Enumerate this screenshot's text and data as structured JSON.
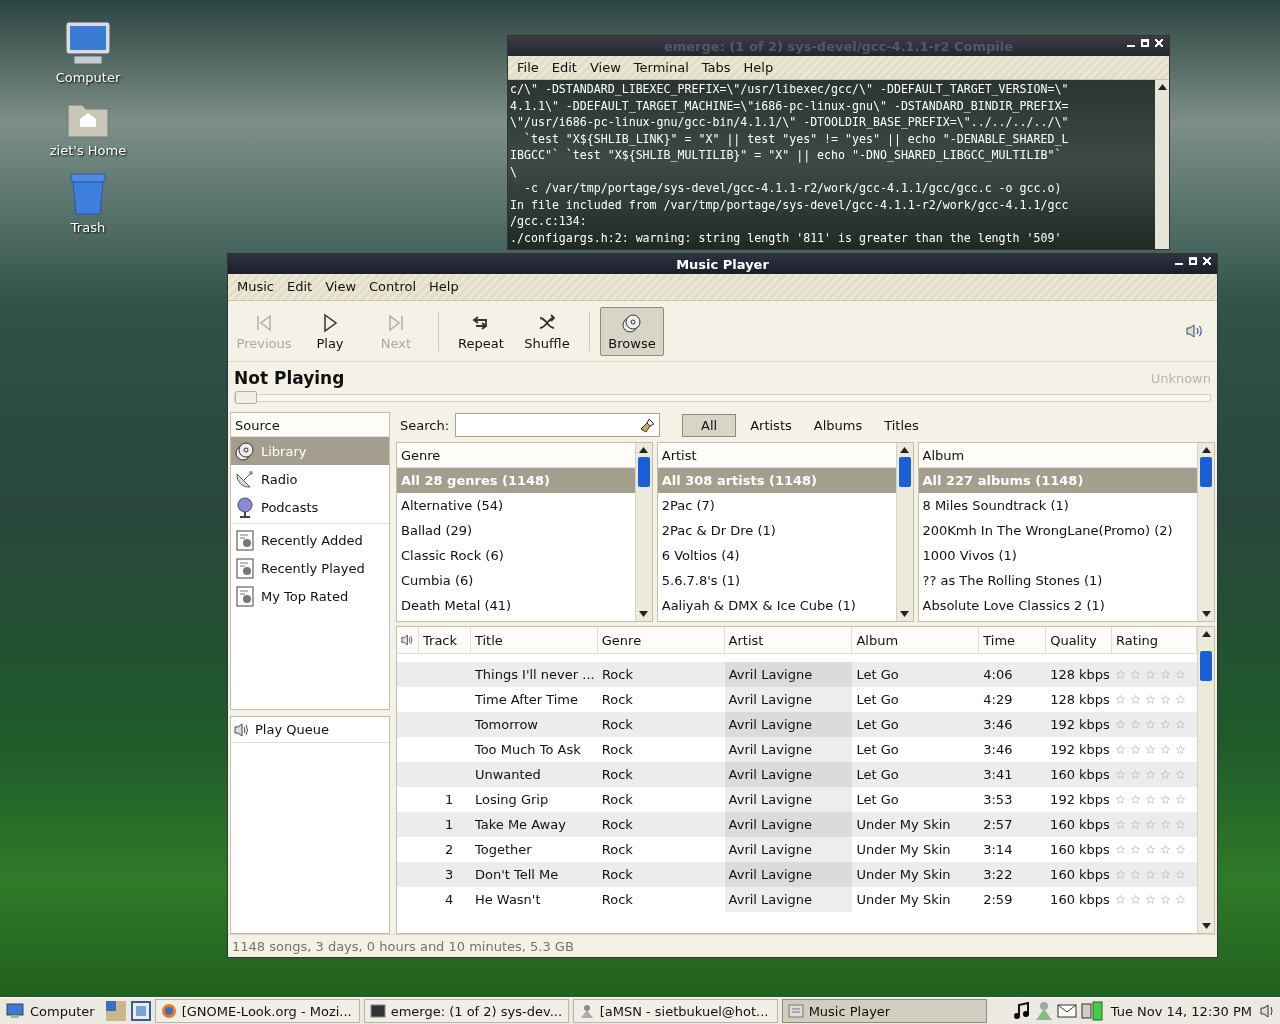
{
  "desktop_icons": [
    {
      "label": "Computer",
      "kind": "computer"
    },
    {
      "label": "ziet's Home",
      "kind": "home"
    },
    {
      "label": "Trash",
      "kind": "trash"
    }
  ],
  "terminal": {
    "title": "emerge: (1 of 2) sys-devel/gcc-4.1.1-r2 Compile",
    "menu": [
      "File",
      "Edit",
      "View",
      "Terminal",
      "Tabs",
      "Help"
    ],
    "lines": [
      "c/\\\" -DSTANDARD_LIBEXEC_PREFIX=\\\"/usr/libexec/gcc/\\\" -DDEFAULT_TARGET_VERSION=\\\"",
      "4.1.1\\\" -DDEFAULT_TARGET_MACHINE=\\\"i686-pc-linux-gnu\\\" -DSTANDARD_BINDIR_PREFIX=",
      "\\\"/usr/i686-pc-linux-gnu/gcc-bin/4.1.1/\\\" -DTOOLDIR_BASE_PREFIX=\\\"../../../../\\\"",
      "  `test \"X${SHLIB_LINK}\" = \"X\" || test \"yes\" != \"yes\" || echo \"-DENABLE_SHARED_L",
      "IBGCC\"` `test \"X${SHLIB_MULTILIB}\" = \"X\" || echo \"-DNO_SHARED_LIBGCC_MULTILIB\"`",
      "\\",
      "  -c /var/tmp/portage/sys-devel/gcc-4.1.1-r2/work/gcc-4.1.1/gcc/gcc.c -o gcc.o)",
      "In file included from /var/tmp/portage/sys-devel/gcc-4.1.1-r2/work/gcc-4.1.1/gcc",
      "/gcc.c:134:",
      "./configargs.h:2: warning: string length '811' is greater than the length '509'"
    ]
  },
  "player": {
    "title": "Music Player",
    "menu": [
      "Music",
      "Edit",
      "View",
      "Control",
      "Help"
    ],
    "toolbar": [
      {
        "label": "Previous",
        "kind": "previous",
        "disabled": true,
        "selected": false
      },
      {
        "label": "Play",
        "kind": "play",
        "disabled": false,
        "selected": false
      },
      {
        "label": "Next",
        "kind": "next",
        "disabled": true,
        "selected": false
      },
      {
        "label": "Repeat",
        "kind": "repeat",
        "disabled": false,
        "selected": false
      },
      {
        "label": "Shuffle",
        "kind": "shuffle",
        "disabled": false,
        "selected": false
      },
      {
        "label": "Browse",
        "kind": "browse",
        "disabled": false,
        "selected": true
      }
    ],
    "now_playing": "Not Playing",
    "time": "Unknown",
    "seek": {
      "level": 0
    },
    "source_header": "Source",
    "sources": [
      {
        "label": "Library",
        "kind": "library",
        "selected": true
      },
      {
        "label": "Radio",
        "kind": "radio",
        "selected": false
      },
      {
        "label": "Podcasts",
        "kind": "podcasts",
        "selected": false
      },
      {
        "label": "Recently Added",
        "kind": "playlist",
        "selected": false
      },
      {
        "label": "Recently Played",
        "kind": "playlist",
        "selected": false
      },
      {
        "label": "My Top Rated",
        "kind": "playlist",
        "selected": false
      }
    ],
    "queue": "Play Queue",
    "search": {
      "label": "Search:"
    },
    "filter_tabs": [
      {
        "label": "All",
        "selected": true
      },
      {
        "label": "Artists",
        "selected": false
      },
      {
        "label": "Albums",
        "selected": false
      },
      {
        "label": "Titles",
        "selected": false
      }
    ],
    "browsers": [
      {
        "header": "Genre",
        "items": [
          {
            "label": "All 28 genres (1148)",
            "selected": true
          },
          {
            "label": "Alternative (54)",
            "selected": false
          },
          {
            "label": "Ballad (29)",
            "selected": false
          },
          {
            "label": "Classic Rock (6)",
            "selected": false
          },
          {
            "label": "Cumbia (6)",
            "selected": false
          },
          {
            "label": "Death Metal (41)",
            "selected": false
          }
        ]
      },
      {
        "header": "Artist",
        "items": [
          {
            "label": "All 308 artists (1148)",
            "selected": true
          },
          {
            "label": "2Pac (7)",
            "selected": false
          },
          {
            "label": "2Pac & Dr Dre (1)",
            "selected": false
          },
          {
            "label": "6 Voltios (4)",
            "selected": false
          },
          {
            "label": "5.6.7.8's (1)",
            "selected": false
          },
          {
            "label": "Aaliyah & DMX & Ice Cube (1)",
            "selected": false
          }
        ]
      },
      {
        "header": "Album",
        "items": [
          {
            "label": "All 227 albums (1148)",
            "selected": true
          },
          {
            "label": "8 Miles Soundtrack (1)",
            "selected": false
          },
          {
            "label": "200Kmh In The WrongLane(Promo) (2)",
            "selected": false
          },
          {
            "label": "1000 Vivos (1)",
            "selected": false
          },
          {
            "label": "?? as The Rolling Stones (1)",
            "selected": false
          },
          {
            "label": "Absolute Love Classics 2 (1)",
            "selected": false
          }
        ]
      }
    ],
    "columns": [
      "Track",
      "Title",
      "Genre",
      "Artist",
      "Album",
      "Time",
      "Quality",
      "Rating"
    ],
    "rows": [
      {
        "track": "",
        "title": "Things I'll never ...",
        "genre": "Rock",
        "artist": "Avril Lavigne",
        "album": "Let Go",
        "time": "4:06",
        "quality": "128 kbps",
        "stars": 0
      },
      {
        "track": "",
        "title": "Time After Time",
        "genre": "Rock",
        "artist": "Avril Lavigne",
        "album": "Let Go",
        "time": "4:29",
        "quality": "128 kbps",
        "stars": 0
      },
      {
        "track": "",
        "title": "Tomorrow",
        "genre": "Rock",
        "artist": "Avril Lavigne",
        "album": "Let Go",
        "time": "3:46",
        "quality": "192 kbps",
        "stars": 0
      },
      {
        "track": "",
        "title": "Too Much To Ask",
        "genre": "Rock",
        "artist": "Avril Lavigne",
        "album": "Let Go",
        "time": "3:46",
        "quality": "192 kbps",
        "stars": 0
      },
      {
        "track": "",
        "title": "Unwanted",
        "genre": "Rock",
        "artist": "Avril Lavigne",
        "album": "Let Go",
        "time": "3:41",
        "quality": "160 kbps",
        "stars": 0
      },
      {
        "track": "1",
        "title": "Losing Grip",
        "genre": "Rock",
        "artist": "Avril Lavigne",
        "album": "Let Go",
        "time": "3:53",
        "quality": "192 kbps",
        "stars": 0
      },
      {
        "track": "1",
        "title": "Take Me Away",
        "genre": "Rock",
        "artist": "Avril Lavigne",
        "album": "Under My Skin",
        "time": "2:57",
        "quality": "160 kbps",
        "stars": 0
      },
      {
        "track": "2",
        "title": "Together",
        "genre": "Rock",
        "artist": "Avril Lavigne",
        "album": "Under My Skin",
        "time": "3:14",
        "quality": "160 kbps",
        "stars": 0
      },
      {
        "track": "3",
        "title": "Don't Tell Me",
        "genre": "Rock",
        "artist": "Avril Lavigne",
        "album": "Under My Skin",
        "time": "3:22",
        "quality": "160 kbps",
        "stars": 0
      },
      {
        "track": "4",
        "title": "He Wasn't",
        "genre": "Rock",
        "artist": "Avril Lavigne",
        "album": "Under My Skin",
        "time": "2:59",
        "quality": "160 kbps",
        "stars": 0
      }
    ],
    "status_bar": "1148 songs, 3 days, 0 hours and 10 minutes, 5.3 GB"
  },
  "taskbar": {
    "menu": "Computer",
    "tasks": [
      {
        "label": "[GNOME-Look.org - Mozi...",
        "kind": "browser",
        "selected": false
      },
      {
        "label": "emerge: (1 of 2) sys-dev...",
        "kind": "terminal",
        "selected": false
      },
      {
        "label": "[aMSN - sietbukuel@hot...",
        "kind": "messenger",
        "selected": false
      },
      {
        "label": "Music Player",
        "kind": "player",
        "selected": true
      }
    ],
    "clock": "Tue Nov 14, 12:30 PM"
  }
}
